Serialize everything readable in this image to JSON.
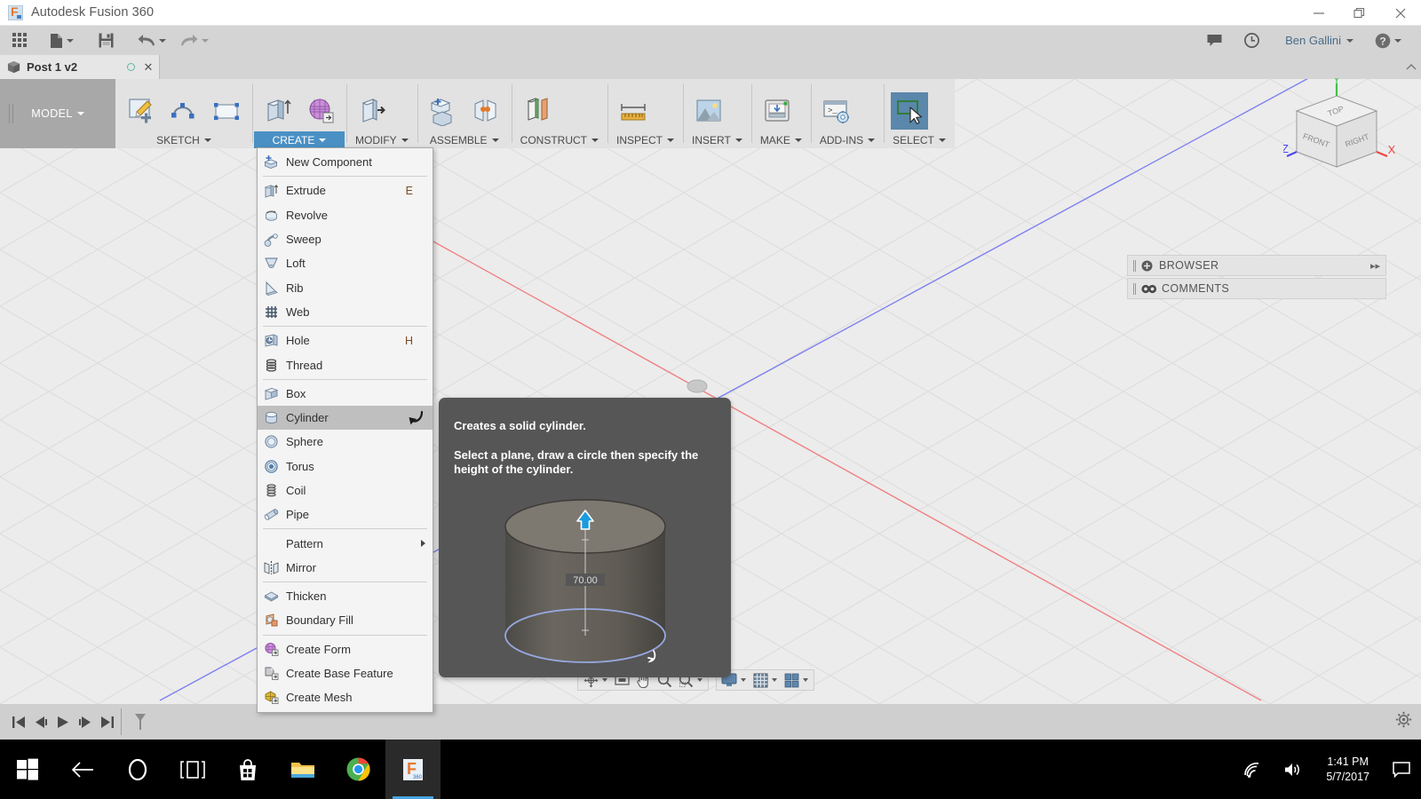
{
  "window": {
    "title": "Autodesk Fusion 360",
    "logo_icon": "fusion-360-logo",
    "minimize_icon": "minimize-icon",
    "restore_icon": "restore-icon",
    "close_icon": "close-icon"
  },
  "quick_access": {
    "items": [
      {
        "name": "app-grid-button",
        "icon": "grid-apps-icon"
      },
      {
        "name": "new-file-button",
        "icon": "file-icon",
        "has_caret": true
      },
      {
        "name": "save-button",
        "icon": "save-floppy-icon"
      },
      {
        "name": "undo-button",
        "icon": "undo-arrow-icon",
        "has_caret": true
      },
      {
        "name": "redo-button",
        "icon": "redo-arrow-icon",
        "has_caret": true
      }
    ],
    "right": {
      "notifications_icon": "speech-bubble-icon",
      "job-status_icon": "clock-icon",
      "user_name": "Ben Gallini",
      "help_icon": "question-mark-icon"
    }
  },
  "document_tab": {
    "icon": "cube-icon",
    "label": "Post 1 v2",
    "status_icon": "sync-circle-icon",
    "close_icon": "close-x-icon"
  },
  "ribbon": {
    "workspace": {
      "label": "MODEL",
      "has_caret": true
    },
    "panels": [
      {
        "title": "SKETCH",
        "active": false,
        "buttons": [
          {
            "name": "create-sketch-button",
            "icon": "sketch-pencil-icon"
          },
          {
            "name": "spline-button",
            "icon": "spline-curve-icon"
          },
          {
            "name": "rectangle-button",
            "icon": "rectangle-icon"
          }
        ]
      },
      {
        "title": "CREATE",
        "active": true,
        "buttons": [
          {
            "name": "extrude-button",
            "icon": "extrude-icon"
          },
          {
            "name": "create-form-button",
            "icon": "create-form-mesh-icon"
          }
        ]
      },
      {
        "title": "MODIFY",
        "active": false,
        "buttons": [
          {
            "name": "press-pull-button",
            "icon": "press-pull-icon"
          }
        ]
      },
      {
        "title": "ASSEMBLE",
        "active": false,
        "buttons": [
          {
            "name": "new-component-button",
            "icon": "new-component-icon"
          },
          {
            "name": "joint-button",
            "icon": "joint-icon"
          }
        ]
      },
      {
        "title": "CONSTRUCT",
        "active": false,
        "buttons": [
          {
            "name": "offset-plane-button",
            "icon": "offset-plane-icon"
          }
        ]
      },
      {
        "title": "INSPECT",
        "active": false,
        "buttons": [
          {
            "name": "measure-button",
            "icon": "ruler-measure-icon"
          }
        ]
      },
      {
        "title": "INSERT",
        "active": false,
        "buttons": [
          {
            "name": "insert-image-button",
            "icon": "picture-image-icon"
          }
        ]
      },
      {
        "title": "MAKE",
        "active": false,
        "buttons": [
          {
            "name": "3d-print-button",
            "icon": "3d-printer-icon"
          }
        ]
      },
      {
        "title": "ADD-INS",
        "active": false,
        "buttons": [
          {
            "name": "scripts-addins-button",
            "icon": "console-gear-icon"
          }
        ]
      },
      {
        "title": "SELECT",
        "active": false,
        "buttons": [
          {
            "name": "select-tool-button",
            "icon": "select-arrow-icon",
            "selected": true
          }
        ]
      }
    ]
  },
  "create_menu": {
    "items": [
      {
        "label": "New Component",
        "icon": "new-component-icon",
        "shortcut": "",
        "separator_after": true
      },
      {
        "label": "Extrude",
        "icon": "extrude-icon",
        "shortcut": "E"
      },
      {
        "label": "Revolve",
        "icon": "revolve-icon",
        "shortcut": ""
      },
      {
        "label": "Sweep",
        "icon": "sweep-icon",
        "shortcut": ""
      },
      {
        "label": "Loft",
        "icon": "loft-icon",
        "shortcut": ""
      },
      {
        "label": "Rib",
        "icon": "rib-icon",
        "shortcut": ""
      },
      {
        "label": "Web",
        "icon": "web-icon",
        "shortcut": "",
        "separator_after": true
      },
      {
        "label": "Hole",
        "icon": "hole-icon",
        "shortcut": "H"
      },
      {
        "label": "Thread",
        "icon": "thread-icon",
        "shortcut": "",
        "separator_after": true
      },
      {
        "label": "Box",
        "icon": "box-icon",
        "shortcut": ""
      },
      {
        "label": "Cylinder",
        "icon": "cylinder-icon",
        "shortcut": "",
        "highlighted": true
      },
      {
        "label": "Sphere",
        "icon": "sphere-icon",
        "shortcut": ""
      },
      {
        "label": "Torus",
        "icon": "torus-icon",
        "shortcut": ""
      },
      {
        "label": "Coil",
        "icon": "coil-icon",
        "shortcut": ""
      },
      {
        "label": "Pipe",
        "icon": "pipe-icon",
        "shortcut": "",
        "separator_after": true
      },
      {
        "label": "Pattern",
        "icon": "",
        "shortcut": "",
        "submenu": true
      },
      {
        "label": "Mirror",
        "icon": "mirror-icon",
        "shortcut": "",
        "separator_after": true
      },
      {
        "label": "Thicken",
        "icon": "thicken-icon",
        "shortcut": ""
      },
      {
        "label": "Boundary Fill",
        "icon": "boundary-fill-icon",
        "shortcut": "",
        "separator_after": true
      },
      {
        "label": "Create Form",
        "icon": "create-form-icon",
        "shortcut": ""
      },
      {
        "label": "Create Base Feature",
        "icon": "create-base-feature-icon",
        "shortcut": ""
      },
      {
        "label": "Create Mesh",
        "icon": "create-mesh-icon",
        "shortcut": ""
      }
    ]
  },
  "tooltip": {
    "title": "Creates a solid cylinder.",
    "body": "Select a plane, draw a circle then specify the height of the cylinder.",
    "preview_icon": "cylinder-preview-image",
    "dimension_label": "70.00"
  },
  "side_panel": {
    "rows": [
      {
        "label": "BROWSER",
        "icon": "browser-plus-icon",
        "expand_icon": "expand-right-icon"
      },
      {
        "label": "COMMENTS",
        "icon": "comments-icon",
        "expand_icon": ""
      }
    ]
  },
  "view_cube": {
    "faces": {
      "top": "TOP",
      "front": "FRONT",
      "right": "RIGHT"
    },
    "axes": [
      {
        "label": "X",
        "color": "#ef4444"
      },
      {
        "label": "Y",
        "color": "#44c244"
      },
      {
        "label": "Z",
        "color": "#4a4aef"
      }
    ]
  },
  "nav_bar": {
    "groups": [
      {
        "buttons": [
          {
            "name": "orbit-button",
            "icon": "orbit-icon",
            "has_caret": true
          },
          {
            "name": "look-at-button",
            "icon": "look-at-icon"
          },
          {
            "name": "pan-button",
            "icon": "pan-hand-icon"
          },
          {
            "name": "zoom-button",
            "icon": "zoom-magnifier-icon"
          },
          {
            "name": "fit-button",
            "icon": "zoom-fit-icon",
            "has_caret": true
          }
        ]
      },
      {
        "buttons": [
          {
            "name": "display-settings-button",
            "icon": "monitor-display-icon",
            "has_caret": true
          },
          {
            "name": "grid-snaps-button",
            "icon": "grid-icon",
            "has_caret": true
          },
          {
            "name": "viewports-button",
            "icon": "viewports-icon",
            "has_caret": true
          }
        ]
      }
    ]
  },
  "timeline": {
    "buttons": [
      {
        "name": "timeline-go-start-button",
        "icon": "skip-to-start-icon"
      },
      {
        "name": "timeline-step-back-button",
        "icon": "step-back-icon"
      },
      {
        "name": "timeline-play-button",
        "icon": "play-icon"
      },
      {
        "name": "timeline-step-forward-button",
        "icon": "step-forward-icon"
      },
      {
        "name": "timeline-go-end-button",
        "icon": "skip-to-end-icon"
      },
      {
        "name": "timeline-marker",
        "icon": "timeline-marker-icon"
      }
    ],
    "settings_icon": "gear-icon"
  },
  "taskbar": {
    "items": [
      {
        "name": "start-button",
        "icon": "windows-logo-icon"
      },
      {
        "name": "back-button",
        "icon": "back-arrow-icon"
      },
      {
        "name": "cortana-button",
        "icon": "cortana-circle-icon"
      },
      {
        "name": "task-view-button",
        "icon": "task-view-icon"
      },
      {
        "name": "store-button",
        "icon": "store-bag-icon"
      },
      {
        "name": "file-explorer-button",
        "icon": "folder-icon"
      },
      {
        "name": "chrome-button",
        "icon": "chrome-icon"
      },
      {
        "name": "fusion-360-button",
        "icon": "fusion-360-icon",
        "active": true
      }
    ],
    "tray": {
      "network_icon": "wifi-icon",
      "volume_icon": "speaker-icon",
      "time": "1:41 PM",
      "date": "5/7/2017",
      "action_center_icon": "action-center-icon"
    }
  },
  "colors": {
    "accent_blue": "#4a90c4",
    "select_blue": "#5a87ab",
    "canvas_bg": "#ececec",
    "tooltip_bg": "#565656",
    "axis_red": "#ef6a6a",
    "axis_blue": "#6a6aef"
  }
}
